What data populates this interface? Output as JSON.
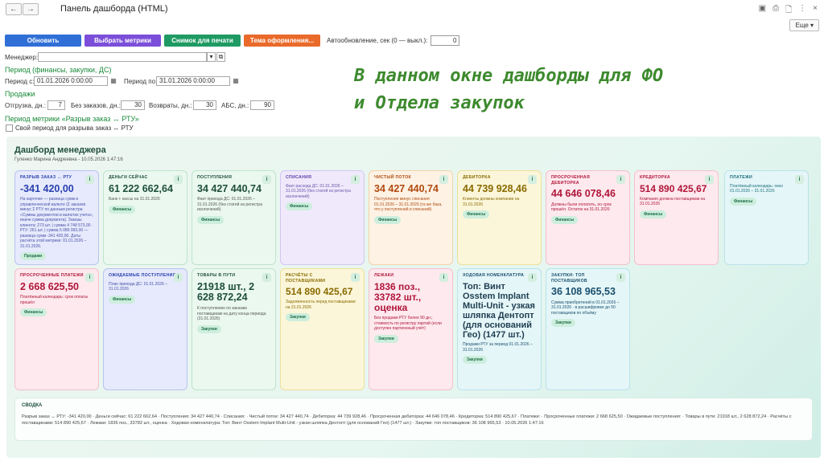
{
  "window": {
    "title": "Панель дашборда (HTML)",
    "back_glyph": "←",
    "forward_glyph": "→",
    "icons": [
      "save-icon",
      "print-icon",
      "preview-icon",
      "more-vert-icon",
      "close-icon"
    ],
    "icon_glyphs": [
      "▣",
      "⎙",
      "🗋",
      "⋮",
      "×"
    ],
    "more_label": "Еще ▾"
  },
  "toolbar": {
    "update_label": "Обновить",
    "metrics_label": "Выбрать метрики",
    "snapshot_label": "Снимок для печати",
    "theme_label": "Тема оформления...",
    "auto_label": "Автообновление, сек (0 — выкл.):",
    "auto_value": "0",
    "colors": {
      "update": "#2f6fd6",
      "metrics": "#7b4fd9",
      "snapshot": "#1f9a63",
      "theme": "#e96a2a"
    }
  },
  "form": {
    "manager_label": "Менеджер:",
    "manager_value": "",
    "period_head": "Период (финансы, закупки, ДС)",
    "period_from_label": "Период с:",
    "period_from_value": "01.01.2026 0:00:00",
    "period_to_label": "Период по:",
    "period_to_value": "31.01.2026 0:00:00",
    "sales_head": "Продажи",
    "ship_label": "Отгрузка, дн.:",
    "ship_value": "7",
    "noorder_label": "Без заказов, дн.:",
    "noorder_value": "30",
    "returns_label": "Возвраты, дн.:",
    "returns_value": "30",
    "abc_label": "АБС, дн.:",
    "abc_value": "90",
    "gap_head": "Период метрики «Разрыв заказ ↔ РТУ»",
    "own_period_label": "Свой период для разрыва заказ ↔ РТУ"
  },
  "note": {
    "line1": "В данном окне дашборды для ФО",
    "line2": "и Отдела закупок"
  },
  "dashboard": {
    "title": "Дашборд менеджера",
    "subtitle": "Гуленко Марина Андреевна - 10.05.2026 1:47:16",
    "info_glyph": "i",
    "cards": [
      {
        "caption": "РАЗРЫВ ЗАКАЗ ↔ РТУ",
        "value": "-341 420,00",
        "desc": "На карточке — разница сумм в управленческой валюте (Σ заказов минус Σ РТУ по данным регистра «Суммы документов в валютах учета», иначе сумма документа). Заказы клиента: 273 шт. | сумма 4 748 573,00 · РТУ: 261 шт. | сумма 5 089 993,00 — разница сумм -341 420,00. Даты расчёта этой метрики: 01.01.2026 – 31.01.2026.",
        "tag": "Продажи",
        "color": "#2a3fae"
      },
      {
        "caption": "ДЕНЬГИ СЕЙЧАС",
        "value": "61 222 662,64",
        "desc": "Банк + кассы на 31.01.2026",
        "tag": "Финансы",
        "color": "#1f4e3d"
      },
      {
        "caption": "ПОСТУПЛЕНИЯ",
        "value": "34 427 440,74",
        "desc": "Факт прихода ДС: 01.01.2026 – 31.01.2026 (без статей из регистра исключений)",
        "tag": "Финансы",
        "color": "#1f4e3d"
      },
      {
        "caption": "СПИСАНИЯ",
        "value": "",
        "desc": "Факт расхода ДС: 01.01.2026 – 31.01.2026 (без статей из регистра исключений)",
        "tag": "Финансы",
        "color": "#5b3fa6"
      },
      {
        "caption": "ЧИСТЫЙ ПОТОК",
        "value": "34 427 440,74",
        "desc": "Поступления минус списания 01.01.2026 – 31.01.2026 (та же база, что у поступлений и списаний)",
        "tag": "Финансы",
        "color": "#b14a10"
      },
      {
        "caption": "ДЕБИТОРКА",
        "value": "44 739 928,46",
        "desc": "Клиенты должны компании на 31.01.2026",
        "tag": "Финансы",
        "color": "#8a6a00"
      },
      {
        "caption": "ПРОСРОЧЕННАЯ ДЕБИТОРКА",
        "value": "44 646 078,46",
        "desc": "Должны были оплатить, но срок прошёл. Остаток на 31.01.2026",
        "tag": "Финансы",
        "color": "#b0163a"
      },
      {
        "caption": "КРЕДИТОРКА",
        "value": "514 890 425,67",
        "desc": "Компания должна поставщикам на 31.01.2026",
        "tag": "Финансы",
        "color": "#b0163a"
      },
      {
        "caption": "ПЛАТЕЖИ",
        "value": "",
        "desc": "Платёжный календарь: окно 01.01.2026 – 31.01.2026",
        "tag": "Финансы",
        "color": "#1a6f7e"
      },
      {
        "caption": "ПРОСРОЧЕННЫЕ ПЛАТЕЖИ",
        "value": "2 668 625,50",
        "desc": "Платёжный календарь: срок оплаты прошёл",
        "tag": "Финансы",
        "color": "#b0163a"
      },
      {
        "caption": "ОЖИДАЕМЫЕ ПОСТУПЛЕНИЯ",
        "value": "",
        "desc": "План прихода ДС: 01.01.2026 – 31.01.2026",
        "tag": "Финансы",
        "color": "#2a3fae"
      },
      {
        "caption": "ТОВАРЫ В ПУТИ",
        "value": "21918 шт., 2 628 872,24",
        "desc": "К поступлению по заказам поставщикам на дату конца периода (31.01.2026)",
        "tag": "Закупки",
        "color": "#1f4e3d"
      },
      {
        "caption": "РАСЧЁТЫ С ПОСТАВЩИКАМИ",
        "value": "514 890 425,67",
        "desc": "Задолженность перед поставщиками на 31.01.2026",
        "tag": "Закупки",
        "color": "#8a6a00"
      },
      {
        "caption": "ЛЕЖАКИ",
        "value": "1836 поз., 33782 шт., оценка",
        "desc": "Без продажи РТУ более 90 дн.; стоимость по регистру партий (если доступен партионный учёт)",
        "tag": "Закупки",
        "color": "#b0163a"
      },
      {
        "caption": "ХОДОВАЯ НОМЕНКЛАТУРА",
        "value": "Топ: Винт Osstem Implant Multi-Unit - узкая шляпка Дентопт (для оснований Гео) (1477 шт.)",
        "desc": "Продажи РТУ за период 01.01.2026 – 31.01.2026",
        "tag": "Закупки",
        "color": "#1f4e3d"
      },
      {
        "caption": "ЗАКУПКИ: ТОП ПОСТАВЩИКОВ",
        "value": "36 108 965,53",
        "desc": "Сумма приобретений в 01.01.2026 – 31.01.2026 · в расшифровке до 50 поставщиков по объёму",
        "tag": "Закупки",
        "color": "#1a4f6e"
      }
    ],
    "summary_title": "СВОДКА",
    "summary_text": "Разрыв заказ ↔ РТУ: -341 420,00 · Деньги сейчас: 61 222 662,64 · Поступления: 34 427 440,74 · Списания: · Чистый поток: 34 427 440,74 · Дебиторка: 44 739 928,46 · Просроченная дебиторка: 44 646 078,46 · Кредиторка: 514 890 425,67 · Платежи: · Просроченные платежи: 2 668 625,50 · Ожидаемые поступления: · Товары в пути: 21918 шт., 2 628 872,24 · Расчёты с поставщиками: 514 890 425,67 · Лежаки: 1836 поз., 33782 шт., оценка · Ходовая номенклатура: Топ: Винт Osstem Implant Multi-Unit - узкая шляпка Дентопт (для оснований Гео) (1477 шт.) · Закупки: топ поставщиков: 36 108 965,53 · 10.05.2026 1:47:16"
  }
}
